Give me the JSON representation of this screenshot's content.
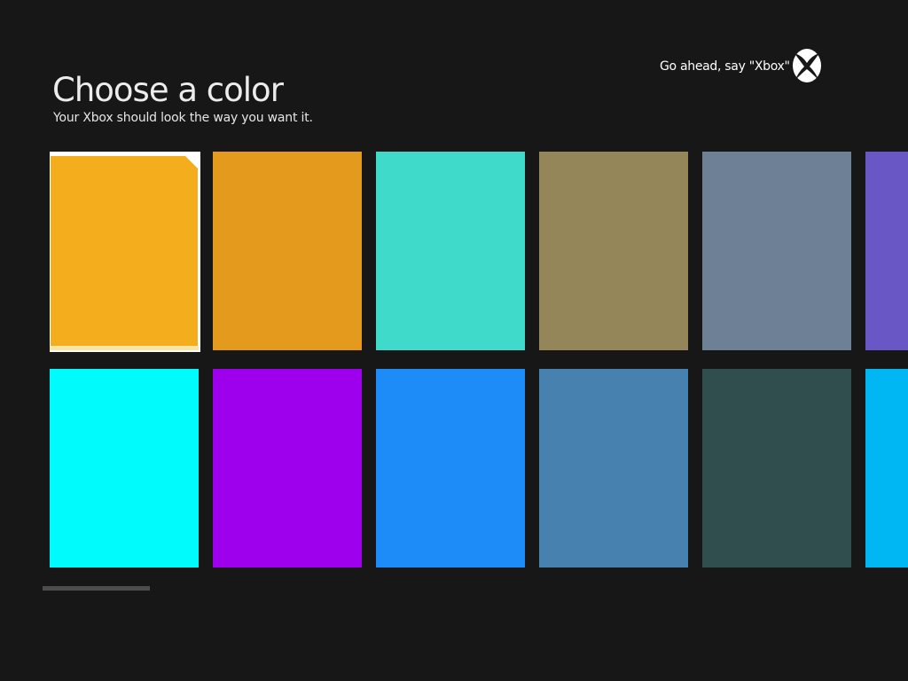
{
  "header": {
    "title": "Choose a color",
    "subtitle": "Your Xbox should look the way you want it."
  },
  "voice_hint": {
    "text": "Go ahead, say \"Xbox\"",
    "icon": "xbox-logo-icon"
  },
  "colors": {
    "background": "#171717",
    "selection_outline": "#ffffff"
  },
  "tiles": [
    {
      "color": "#f4ad1c",
      "selected": true
    },
    {
      "color": "#e39a1d",
      "selected": false
    },
    {
      "color": "#40dacb",
      "selected": false
    },
    {
      "color": "#95865a",
      "selected": false
    },
    {
      "color": "#6e8096",
      "selected": false
    },
    {
      "color": "#6a57c6",
      "selected": false
    },
    {
      "color": "#00fbfc",
      "selected": false
    },
    {
      "color": "#9e00ee",
      "selected": false
    },
    {
      "color": "#1e8cf8",
      "selected": false
    },
    {
      "color": "#4681b0",
      "selected": false
    },
    {
      "color": "#2f4e4d",
      "selected": false
    },
    {
      "color": "#00b7f4",
      "selected": false
    }
  ]
}
